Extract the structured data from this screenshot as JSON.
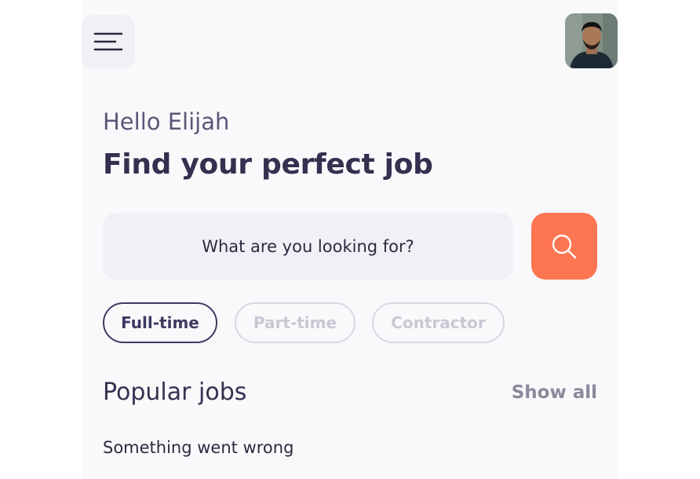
{
  "header": {
    "menu_icon": "menu-icon",
    "avatar_icon": "user-avatar"
  },
  "greeting": "Hello Elijah",
  "headline": "Find your perfect job",
  "search": {
    "placeholder": "What are you looking for?",
    "button_icon": "search-icon"
  },
  "filters": [
    {
      "label": "Full-time",
      "active": true
    },
    {
      "label": "Part-time",
      "active": false
    },
    {
      "label": "Contractor",
      "active": false
    }
  ],
  "popular": {
    "title": "Popular jobs",
    "show_all": "Show all",
    "error": "Something went wrong"
  },
  "colors": {
    "accent": "#fd7551",
    "primary_text": "#34304f",
    "background": "#f9f9fc"
  }
}
